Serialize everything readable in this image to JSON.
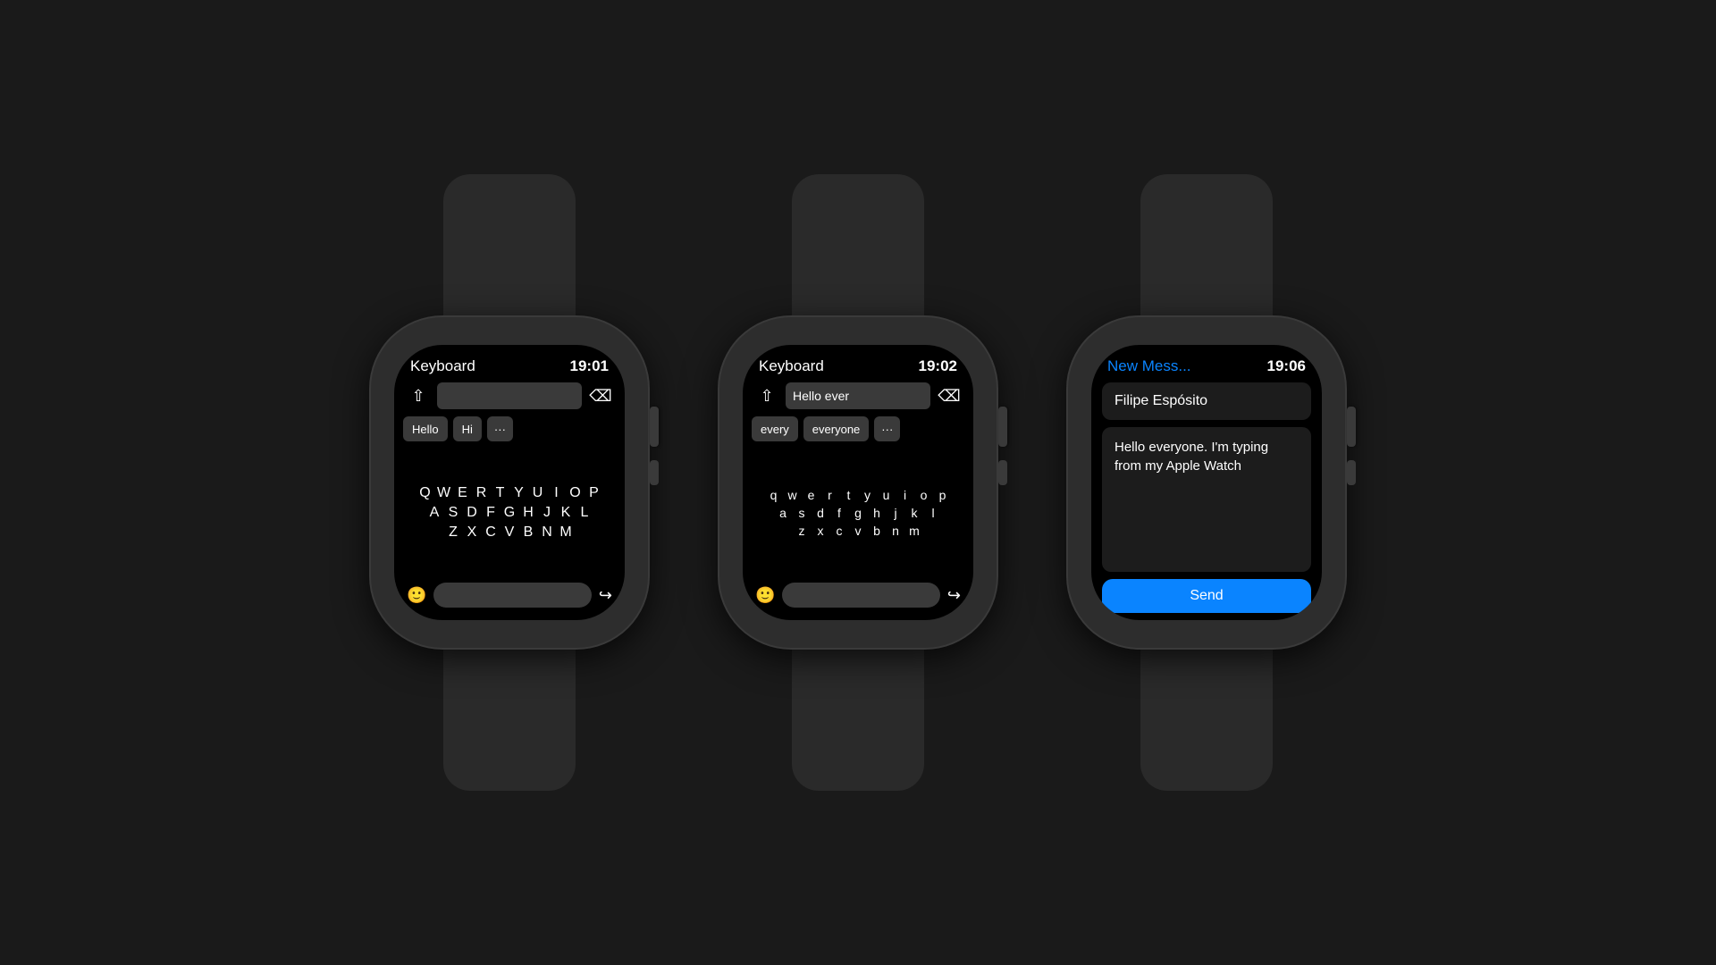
{
  "background": "#1a1a1a",
  "watches": [
    {
      "id": "watch1",
      "screen_title": "Keyboard",
      "screen_time": "19:01",
      "title_color": "white",
      "input_text": "",
      "suggestions": [
        "Hello",
        "Hi",
        "···"
      ],
      "keyboard_rows": [
        [
          "Q",
          "W",
          "E",
          "R",
          "T",
          "Y",
          "U",
          "I",
          "O",
          "P"
        ],
        [
          "A",
          "S",
          "D",
          "F",
          "G",
          "H",
          "J",
          "K",
          "L"
        ],
        [
          "Z",
          "X",
          "C",
          "V",
          "B",
          "N",
          "M"
        ]
      ],
      "keyboard_case": "upper"
    },
    {
      "id": "watch2",
      "screen_title": "Keyboard",
      "screen_time": "19:02",
      "title_color": "white",
      "input_text": "Hello ever",
      "suggestions": [
        "every",
        "everyone",
        "···"
      ],
      "keyboard_rows": [
        [
          "q",
          "w",
          "e",
          "r",
          "t",
          "y",
          "u",
          "i",
          "o",
          "p"
        ],
        [
          "a",
          "s",
          "d",
          "f",
          "g",
          "h",
          "j",
          "k",
          "l"
        ],
        [
          "z",
          "x",
          "c",
          "v",
          "b",
          "n",
          "m"
        ]
      ],
      "keyboard_case": "lower"
    },
    {
      "id": "watch3",
      "screen_title": "New Mess...",
      "screen_time": "19:06",
      "title_color": "blue",
      "contact": "Filipe Espósito",
      "message": "Hello everyone. I'm typing from my Apple Watch",
      "send_label": "Send"
    }
  ]
}
